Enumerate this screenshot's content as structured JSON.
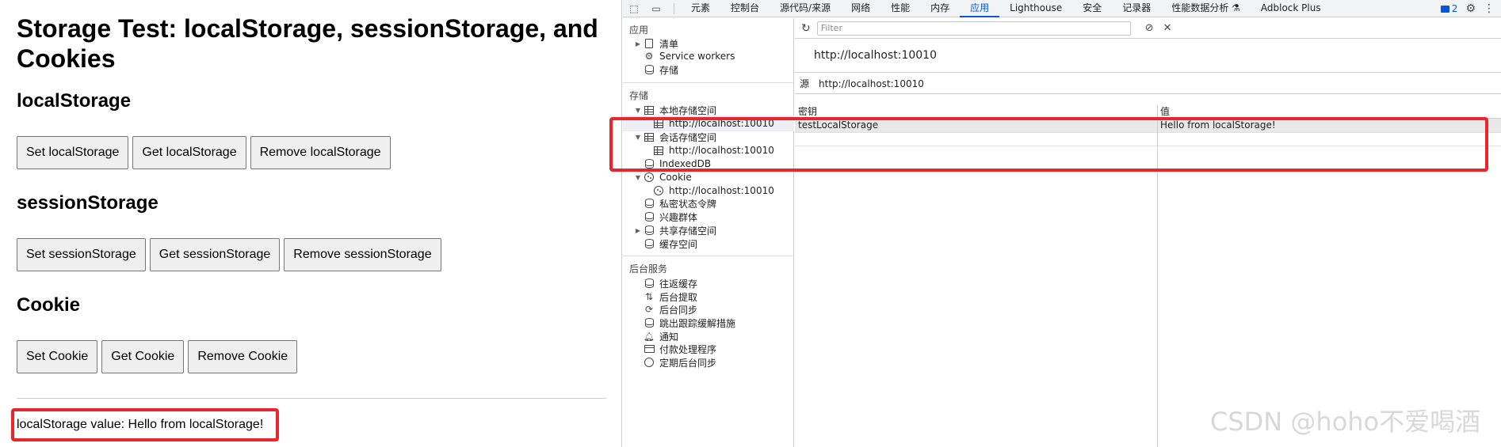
{
  "page": {
    "title": "Storage Test: localStorage, sessionStorage, and Cookies",
    "sections": {
      "local": {
        "heading": "localStorage",
        "buttons": [
          "Set localStorage",
          "Get localStorage",
          "Remove localStorage"
        ]
      },
      "session": {
        "heading": "sessionStorage",
        "buttons": [
          "Set sessionStorage",
          "Get sessionStorage",
          "Remove sessionStorage"
        ]
      },
      "cookie": {
        "heading": "Cookie",
        "buttons": [
          "Set Cookie",
          "Get Cookie",
          "Remove Cookie"
        ]
      }
    },
    "result": "localStorage value: Hello from localStorage!"
  },
  "devtools": {
    "tabs": [
      "元素",
      "控制台",
      "源代码/来源",
      "网络",
      "性能",
      "内存",
      "应用",
      "Lighthouse",
      "安全",
      "记录器",
      "性能数据分析 ⚗",
      "Adblock Plus"
    ],
    "active_tab": "应用",
    "issues_count": "2",
    "sidebar": {
      "app_title": "应用",
      "app_items": [
        "清单",
        "Service workers",
        "存储"
      ],
      "storage_title": "存储",
      "storage_items": {
        "local": "本地存储空间",
        "local_origin": "http://localhost:10010",
        "session": "会话存储空间",
        "session_origin": "http://localhost:10010",
        "indexeddb": "IndexedDB",
        "cookie": "Cookie",
        "cookie_origin": "http://localhost:10010",
        "private_tokens": "私密状态令牌",
        "interest_groups": "兴趣群体",
        "shared_storage": "共享存储空间",
        "cache_storage": "缓存空间"
      },
      "background_title": "后台服务",
      "background_items": [
        "往返缓存",
        "后台提取",
        "后台同步",
        "跳出跟踪缓解措施",
        "通知",
        "付款处理程序",
        "定期后台同步"
      ]
    },
    "main": {
      "filter_placeholder": "Filter",
      "origin_url": "http://localhost:10010",
      "origin_label": "源",
      "origin_value": "http://localhost:10010",
      "col_key": "密钥",
      "col_value": "值",
      "rows": [
        {
          "key": "testLocalStorage",
          "value": "Hello from localStorage!"
        }
      ]
    }
  },
  "watermark": "CSDN @hoho不爱喝酒",
  "colors": {
    "highlight_border": "#e8262c",
    "active_tab": "#0b57d0"
  }
}
